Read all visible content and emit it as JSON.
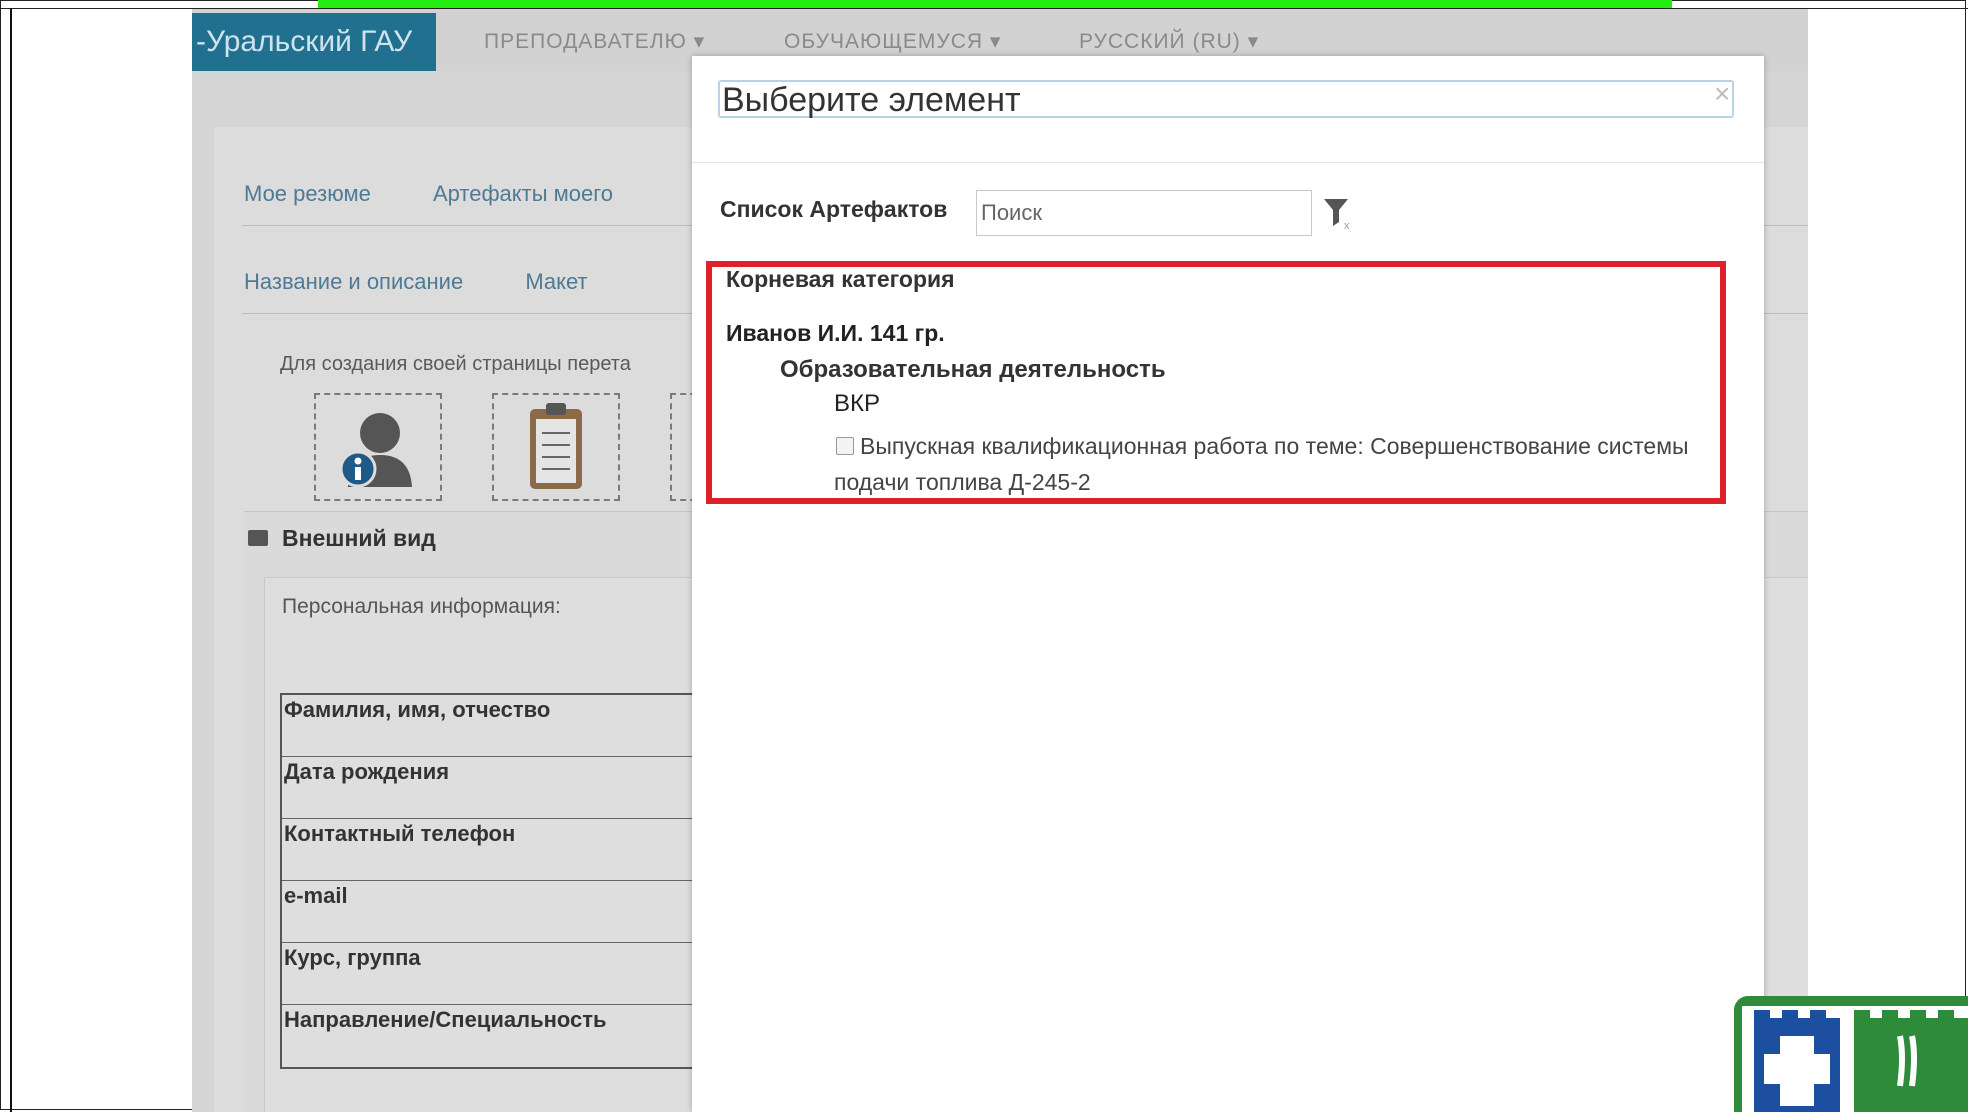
{
  "app": {
    "brand": "-Уральский ГАУ",
    "nav": [
      "ПРЕПОДАВАТЕЛЮ ▾",
      "ОБУЧАЮЩЕМУСЯ ▾",
      "РУССКИЙ (RU) ▾"
    ],
    "tabs_row1": [
      "Мое резюме",
      "Артефакты моего"
    ],
    "tabs_row2": [
      "Название и описание",
      "Макет"
    ],
    "hint": "Для создания своей страницы перета",
    "appearance_title": "Внешний вид",
    "personal_info_label": "Персональная информация:",
    "info_rows": [
      "Фамилия, имя, отчество",
      "Дата рождения",
      "Контактный телефон",
      "e-mail",
      "Курс, группа",
      "Направление/Специальность"
    ]
  },
  "modal": {
    "title": "Выберите элемент",
    "close": "×",
    "list_label": "Список Артефактов",
    "search_placeholder": "Поиск",
    "tree": {
      "root": "Корневая категория",
      "level0": "Иванов И.И. 141 гр.",
      "level1": "Образовательная деятельность",
      "level2": "ВКР",
      "leaf": "Выпускная квалификационная работа по теме: Совершенствование системы подачи топлива Д-245-2",
      "leaf_checked": false
    }
  },
  "colors": {
    "brand_bg": "#21708f",
    "highlight": "#e0202b",
    "banner": "#22ee11",
    "link": "#4d7a95"
  },
  "icons": [
    "user-info-icon",
    "clipboard-icon",
    "briefcase-icon",
    "filter-clear-icon",
    "close-icon",
    "checkbox-icon"
  ]
}
